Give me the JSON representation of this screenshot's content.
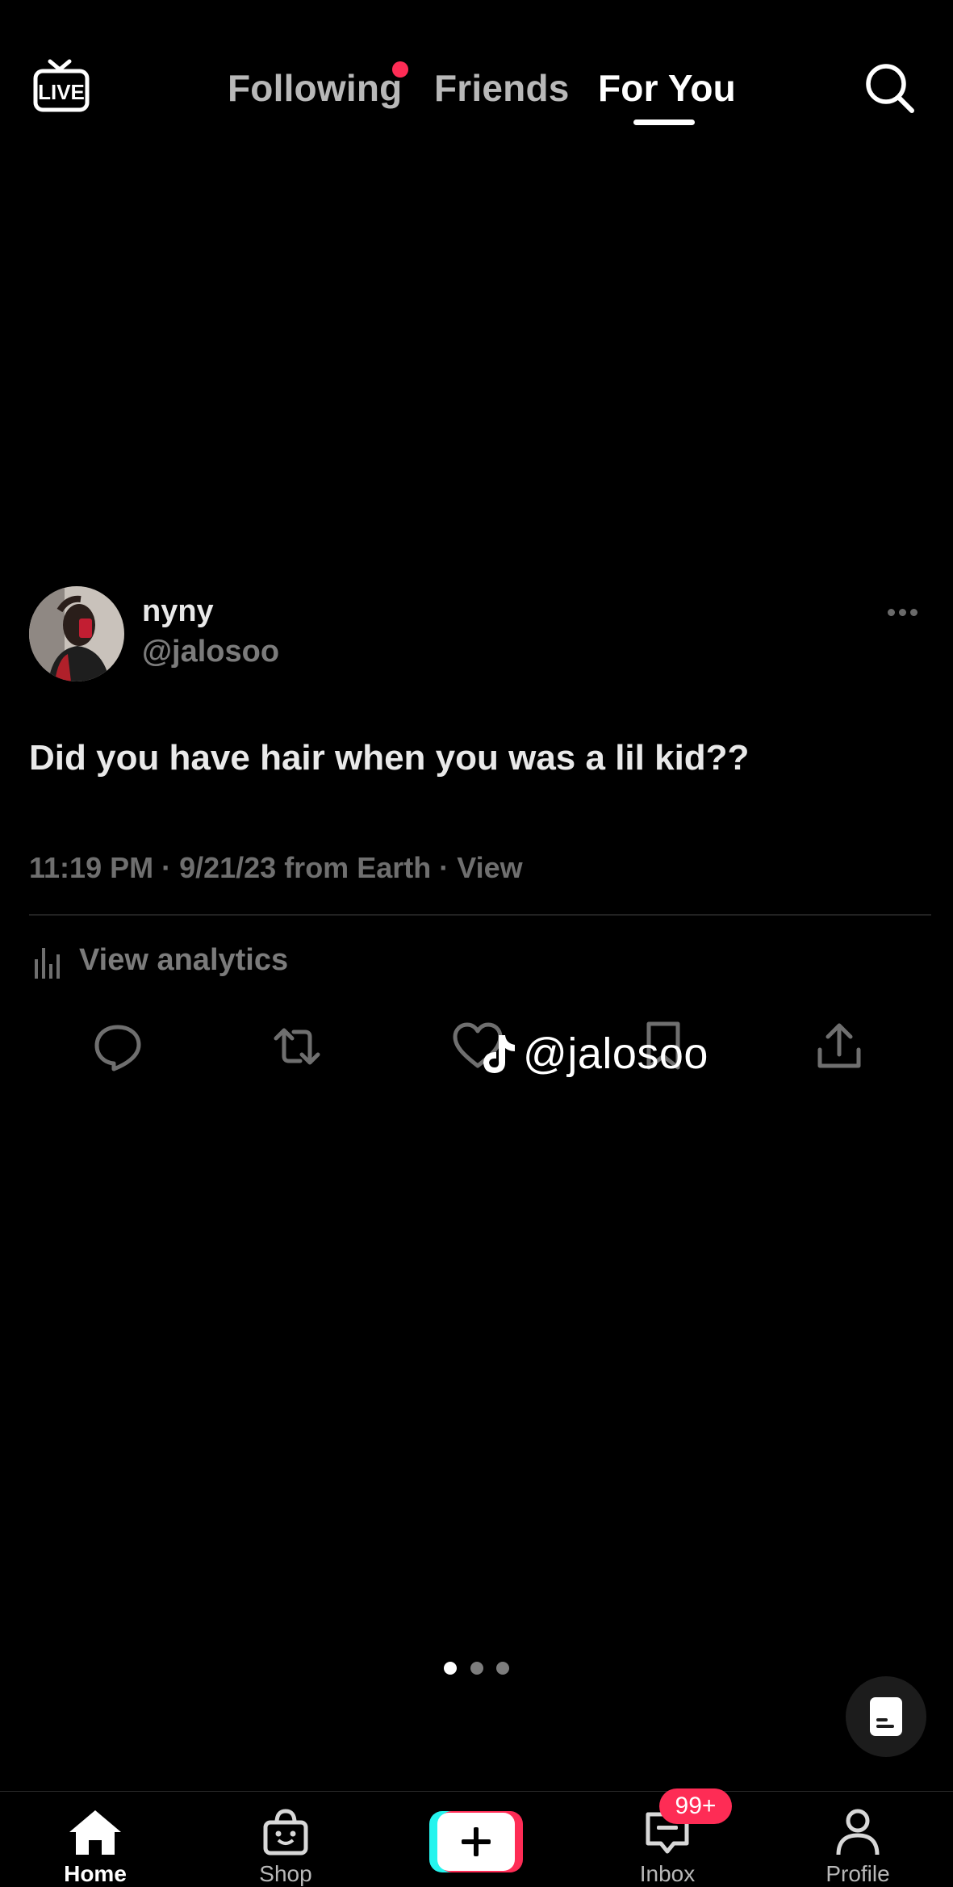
{
  "header": {
    "live_label": "LIVE",
    "tabs": [
      {
        "label": "Following",
        "has_notification": true
      },
      {
        "label": "Friends"
      },
      {
        "label": "For You",
        "active": true
      }
    ],
    "search_icon": "search-icon"
  },
  "post": {
    "display_name": "nyny",
    "handle": "@jalosoo",
    "text": "Did you have hair when you was a lil kid??",
    "meta": "11:19 PM · 9/21/23 from Earth · View",
    "analytics_label": "View analytics",
    "actions": [
      "reply-icon",
      "retweet-icon",
      "heart-icon",
      "bookmark-icon",
      "share-icon"
    ]
  },
  "watermark": {
    "handle": "@jalosoo"
  },
  "carousel": {
    "page_count": 3,
    "active_index": 0
  },
  "bottom_nav": {
    "items": [
      {
        "label": "Home",
        "icon": "home-icon",
        "active": true
      },
      {
        "label": "Shop",
        "icon": "shop-bag-icon"
      },
      {
        "label": "",
        "icon": "plus-icon"
      },
      {
        "label": "Inbox",
        "icon": "inbox-icon",
        "badge": "99+"
      },
      {
        "label": "Profile",
        "icon": "profile-icon"
      }
    ]
  },
  "colors": {
    "background": "#000000",
    "accent_red": "#fe2c55",
    "accent_cyan": "#25f4ee",
    "inactive_text": "#b8b8b8"
  }
}
